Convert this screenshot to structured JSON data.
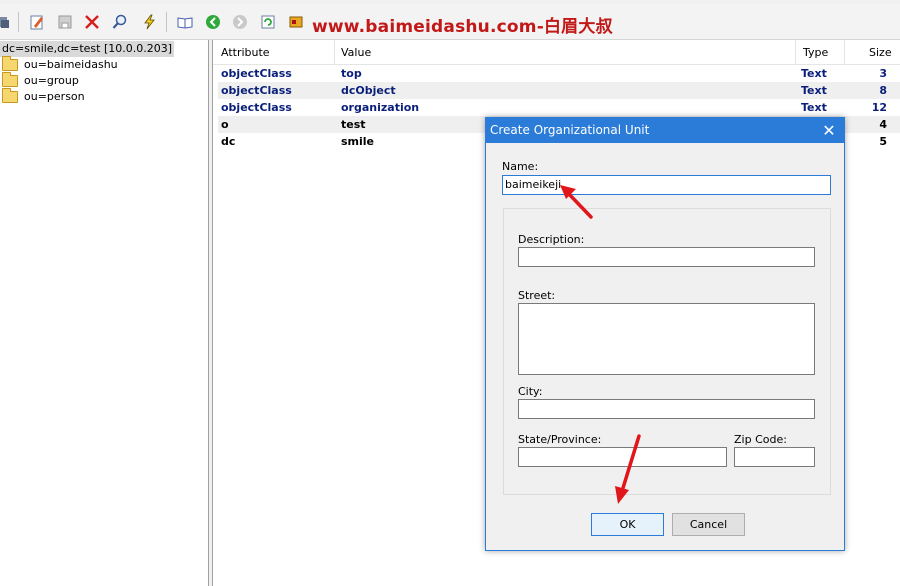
{
  "toolbar": {
    "icons": [
      "gear-icon",
      "edit-icon",
      "save-icon",
      "delete-icon",
      "search-icon",
      "lightning-icon",
      "book-icon",
      "back-icon",
      "forward-icon",
      "refresh-icon",
      "export-icon"
    ],
    "watermark": "www.baimeidashu.com-白眉大叔"
  },
  "tree": {
    "root": "dc=smile,dc=test [10.0.0.203]",
    "items": [
      "ou=baimeidashu",
      "ou=group",
      "ou=person"
    ]
  },
  "table": {
    "headers": [
      "Attribute",
      "Value",
      "Type",
      "Size"
    ],
    "rows": [
      {
        "attribute": "objectClass",
        "value": "top",
        "type": "Text",
        "size": "3"
      },
      {
        "attribute": "objectClass",
        "value": "dcObject",
        "type": "Text",
        "size": "8"
      },
      {
        "attribute": "objectClass",
        "value": "organization",
        "type": "Text",
        "size": "12"
      },
      {
        "attribute": "o",
        "value": "test",
        "type": "",
        "size": "4"
      },
      {
        "attribute": "dc",
        "value": "smile",
        "type": "",
        "size": "5"
      }
    ]
  },
  "dialog": {
    "title": "Create Organizational Unit",
    "close_glyph": "✕",
    "name_label": "Name:",
    "name_value": "baimeikeji",
    "description_label": "Description:",
    "street_label": "Street:",
    "city_label": "City:",
    "state_label": "State/Province:",
    "zip_label": "Zip Code:",
    "ok_label": "OK",
    "cancel_label": "Cancel"
  },
  "colors": {
    "accent": "#2b7bd8",
    "attribute_text": "#0a1f7a",
    "watermark": "#c21818",
    "annotation_arrow": "#e0161b"
  }
}
